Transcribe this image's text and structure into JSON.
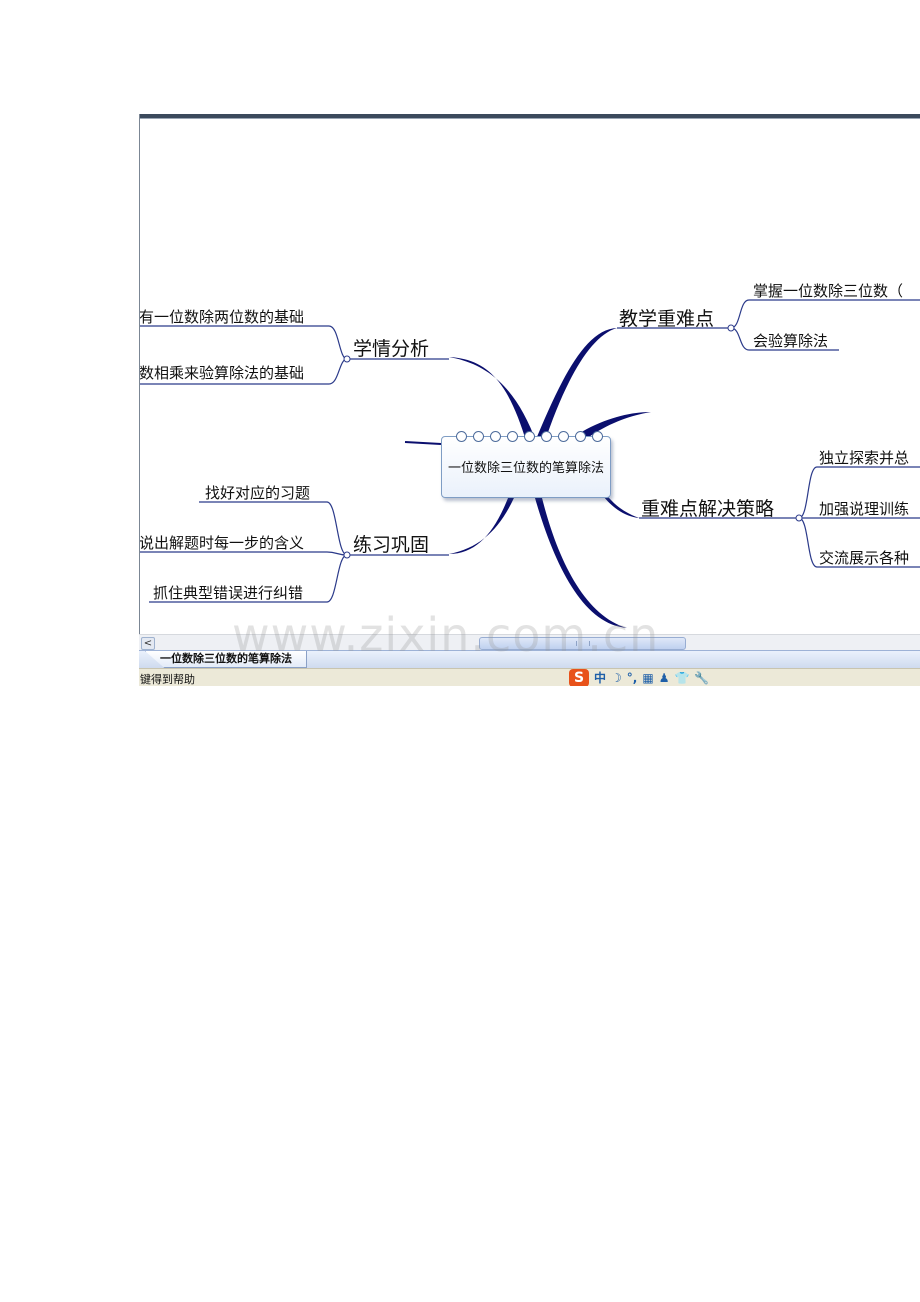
{
  "mindmap": {
    "center": "一位数除三位数的笔算除法",
    "branches": [
      {
        "label": "学情分析",
        "children": [
          "有一位数除两位数的基础",
          "数相乘来验算除法的基础"
        ]
      },
      {
        "label": "教学重难点",
        "children": [
          "掌握一位数除三位数（",
          "会验算除法"
        ]
      },
      {
        "label": "练习巩固",
        "children": [
          "找好对应的习题",
          "说出解题时每一步的含义",
          "抓住典型错误进行纠错"
        ]
      },
      {
        "label": "重难点解决策略",
        "children": [
          "独立探索并总",
          "加强说理训练",
          "交流展示各种"
        ]
      }
    ],
    "colors": {
      "branch": "#0b0f6e",
      "connector": "#2b3a8a"
    }
  },
  "scrollbar": {
    "left_arrow": "<",
    "grip": "III"
  },
  "tab": {
    "label": "一位数除三位数的笔算除法"
  },
  "status": {
    "text": "键得到帮助",
    "ime_logo": "S",
    "ime_mode": "中",
    "ime_moon": "☽",
    "ime_punct": "°,",
    "ime_keyboard": "▦",
    "ime_user": "♟",
    "ime_skin": "👕",
    "ime_tool": "🔧"
  },
  "watermark": "www.zixin.com.cn"
}
